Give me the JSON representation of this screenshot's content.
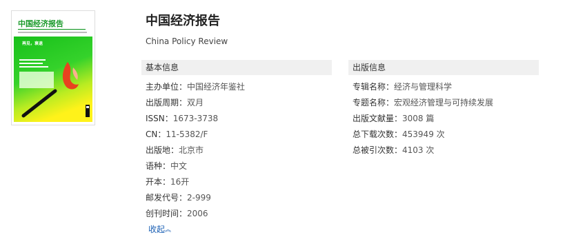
{
  "journal": {
    "title": "中国经济报告",
    "subtitle": "China Policy Review"
  },
  "cover": {
    "masthead": "中国经济报告",
    "headline": "再见，衰退",
    "colors": {
      "green": "#1ec51e",
      "yellow": "#fff21a",
      "red": "#e8431f"
    }
  },
  "basic_info": {
    "header": "基本信息",
    "rows": [
      {
        "key": "主办单位：",
        "value": "中国经济年鉴社"
      },
      {
        "key": "出版周期：",
        "value": "双月"
      },
      {
        "key": "ISSN：",
        "value": "1673-3738"
      },
      {
        "key": "CN：",
        "value": "11-5382/F"
      },
      {
        "key": "出版地：",
        "value": "北京市"
      },
      {
        "key": "语种：",
        "value": "中文"
      },
      {
        "key": "开本：",
        "value": "16开"
      },
      {
        "key": "邮发代号：",
        "value": "2-999"
      },
      {
        "key": "创刊时间：",
        "value": "2006"
      }
    ],
    "collapse_label": "收起",
    "collapse_icon": "double-chevron-up-icon"
  },
  "publication_info": {
    "header": "出版信息",
    "rows": [
      {
        "key": "专辑名称：",
        "value": "经济与管理科学"
      },
      {
        "key": "专题名称：",
        "value": "宏观经济管理与可持续发展"
      },
      {
        "key": "出版文献量：",
        "value": "3008 篇"
      },
      {
        "key": "总下载次数：",
        "value": "453949 次"
      },
      {
        "key": "总被引次数：",
        "value": "4103 次"
      }
    ]
  }
}
